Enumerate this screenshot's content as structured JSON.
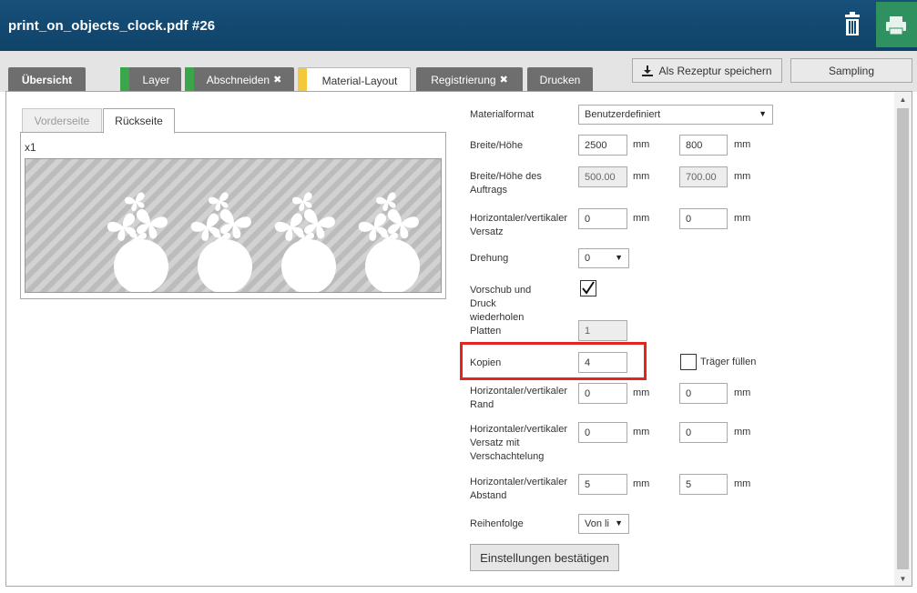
{
  "window": {
    "title": "print_on_objects_clock.pdf #26"
  },
  "header_icons": {
    "trash": "trash-icon",
    "print": "printer-icon",
    "print_bg": "#2f9160"
  },
  "tabs": [
    {
      "label": "Übersicht",
      "marker": null,
      "suffix_icon": null
    },
    {
      "label": "Layer",
      "marker": "#3aa54a",
      "suffix_icon": null
    },
    {
      "label": "Abschneiden",
      "marker": "#3aa54a",
      "suffix_icon": "✖"
    },
    {
      "label": "Material-Layout",
      "marker": "#f3c93b",
      "suffix_icon": null
    },
    {
      "label": "Registrierung",
      "marker": null,
      "suffix_icon": "✖"
    },
    {
      "label": "Drucken",
      "marker": null,
      "suffix_icon": null
    }
  ],
  "toolbar": {
    "save_recipe": "Als Rezeptur speichern",
    "save_icon": "download-icon",
    "sampling": "Sampling"
  },
  "preview": {
    "side_tabs": [
      "Vorderseite",
      "Rückseite"
    ],
    "active_side": "Rückseite",
    "copies_indicator": "x1",
    "object_count": 4
  },
  "form": {
    "material_format": {
      "label": "Materialformat",
      "value": "Benutzerdefiniert"
    },
    "width_height": {
      "label": "Breite/Höhe",
      "width": "2500",
      "height": "800",
      "unit": "mm"
    },
    "job_size": {
      "label": "Breite/Höhe des Auftrags",
      "width": "500.00",
      "height": "700.00",
      "unit": "mm"
    },
    "offset": {
      "label": "Horizontaler/vertikaler Versatz",
      "h": "0",
      "v": "0",
      "unit": "mm"
    },
    "rotation": {
      "label": "Drehung",
      "value": "0"
    },
    "repeat": {
      "label": "Vorschub und Druck wiederholen",
      "checked": true
    },
    "plates": {
      "label": "Platten",
      "value": "1"
    },
    "copies": {
      "label": "Kopien",
      "value": "4",
      "fill_label": "Träger füllen",
      "fill_checked": false
    },
    "margin": {
      "label": "Horizontaler/vertikaler Rand",
      "h": "0",
      "v": "0",
      "unit": "mm"
    },
    "nesting_offset": {
      "label": "Horizontaler/vertikaler Versatz mit Verschachtelung",
      "h": "0",
      "v": "0",
      "unit": "mm"
    },
    "spacing": {
      "label": "Horizontaler/vertikaler Abstand",
      "h": "5",
      "v": "5",
      "unit": "mm"
    },
    "order": {
      "label": "Reihenfolge",
      "value": "Von li"
    },
    "confirm_button": "Einstellungen bestätigen"
  },
  "colors": {
    "title_bar": "#13496f",
    "highlight": "#e32420",
    "tab_inactive": "#6e6e6e"
  }
}
